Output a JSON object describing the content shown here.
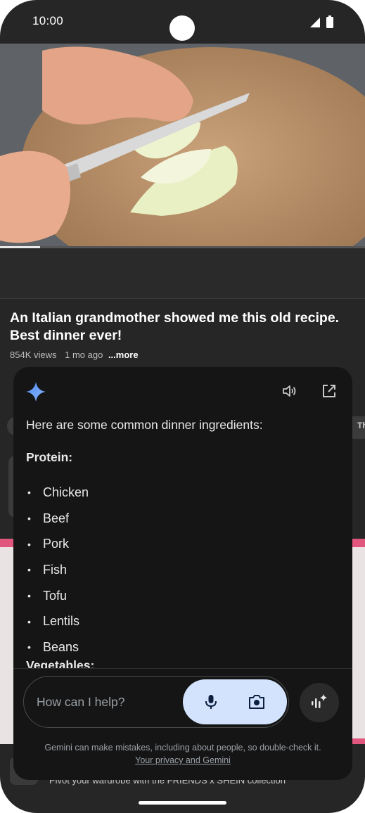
{
  "status_bar": {
    "time": "10:00",
    "icons": [
      "signal-icon",
      "battery-icon"
    ]
  },
  "video": {
    "progress": 0.11
  },
  "video_info": {
    "title": "An Italian grandmother showed me this old recipe. Best dinner ever!",
    "views": "854K views",
    "age": "1 mo ago",
    "more": "...more"
  },
  "background": {
    "footer_text": "Pivot your wardrobe with the FRIENDS x SHEIN collection",
    "chip_partial": "Th"
  },
  "gemini": {
    "intro": "Here are some common dinner ingredients:",
    "protein_heading": "Protein:",
    "protein_items": [
      "Chicken",
      "Beef",
      "Pork",
      "Fish",
      "Tofu",
      "Lentils",
      "Beans"
    ],
    "vegetables_heading": "Vegetables:",
    "input_placeholder": "How can I help?",
    "disclaimer": "Gemini can make mistakes, including about people, so double-check it.",
    "privacy_link": "Your privacy and Gemini",
    "accent_color": "#d3e3fd"
  }
}
